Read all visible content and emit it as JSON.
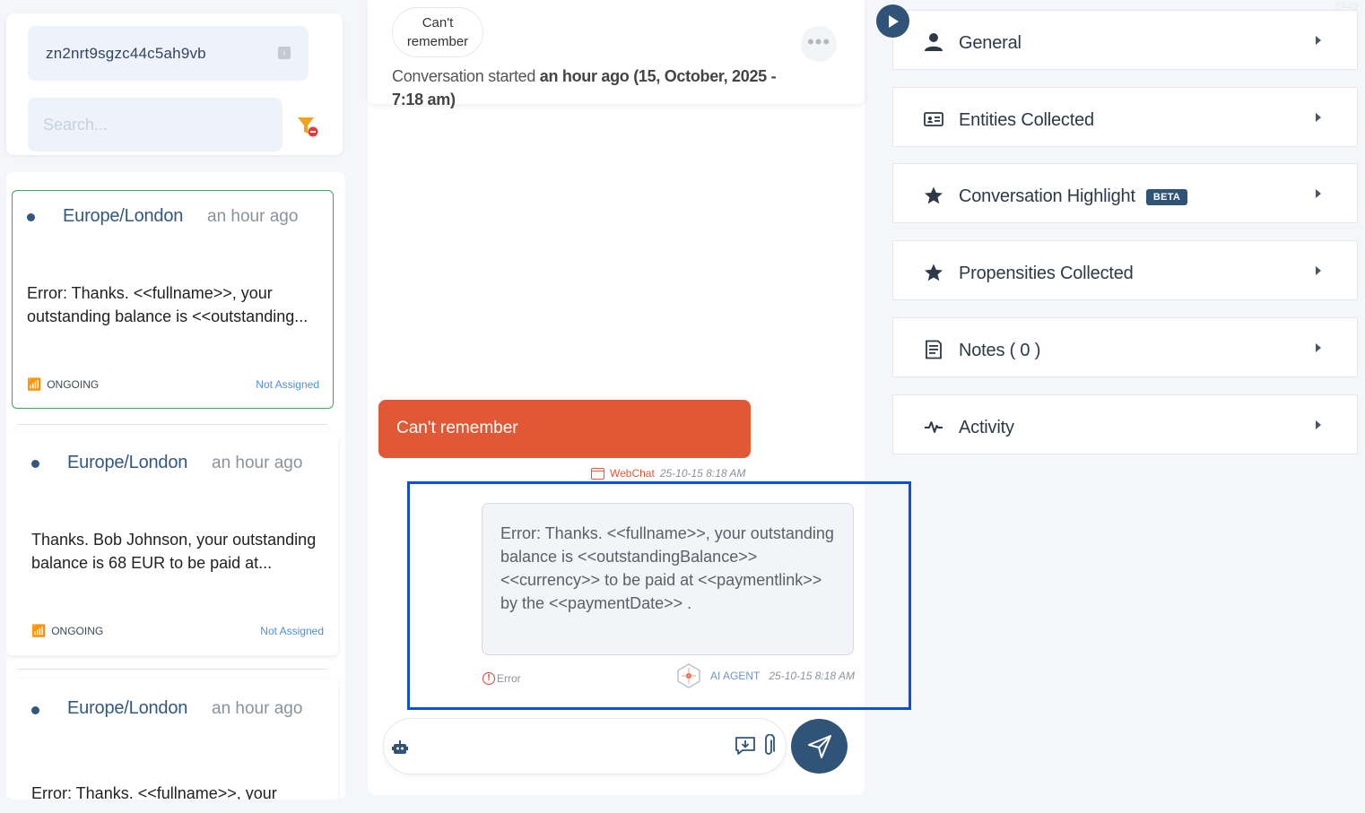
{
  "left": {
    "conversation_id": "zn2nrt9sgzc44c5ah9vb",
    "search_placeholder": "Search..."
  },
  "conversations": [
    {
      "timezone": "Europe/London",
      "time_ago": "an hour ago",
      "preview": "Error: Thanks. <<fullname>>, your outstanding balance is <<outstanding...",
      "status": "ONGOING",
      "assignment": "Not Assigned"
    },
    {
      "timezone": "Europe/London",
      "time_ago": "an hour ago",
      "preview": "Thanks. Bob Johnson, your outstanding balance is 68 EUR to be paid at...",
      "status": "ONGOING",
      "assignment": "Not Assigned"
    },
    {
      "timezone": "Europe/London",
      "time_ago": "an hour ago",
      "preview": "Error: Thanks. <<fullname>>, your"
    }
  ],
  "chat": {
    "top_pill": "Can't remember",
    "started_prefix": "Conversation started ",
    "started_bold": "an hour ago (15, October, 2025 - 7:18 am)",
    "user_message": "Can't remember",
    "user_channel": "WebChat",
    "user_timestamp": "25-10-15 8:18 AM",
    "agent_message": "Error: Thanks. <<fullname>>, your outstanding balance is <<outstandingBalance>> <<currency>> to be paid at <<paymentlink>> by the <<paymentDate>> .",
    "agent_error_label": "Error",
    "agent_label": "AI AGENT",
    "agent_timestamp": "25-10-15 8:18 AM",
    "composer_value": ""
  },
  "right": {
    "corner_text": "2440",
    "sections": [
      {
        "label": "General",
        "icon": "user-icon"
      },
      {
        "label": "Entities Collected",
        "icon": "id-card-icon"
      },
      {
        "label": "Conversation Highlight",
        "icon": "star-icon",
        "badge": "BETA"
      },
      {
        "label": "Propensities Collected",
        "icon": "star-icon"
      },
      {
        "label": "Notes ( 0 )",
        "icon": "notes-icon"
      },
      {
        "label": "Activity",
        "icon": "activity-icon"
      }
    ]
  },
  "colors": {
    "brand": "#2f5478",
    "user_bubble": "#e05835",
    "ongoing_green": "#35a862",
    "link_blue": "#4f8fd8",
    "highlight_box": "#0b4ee0"
  }
}
